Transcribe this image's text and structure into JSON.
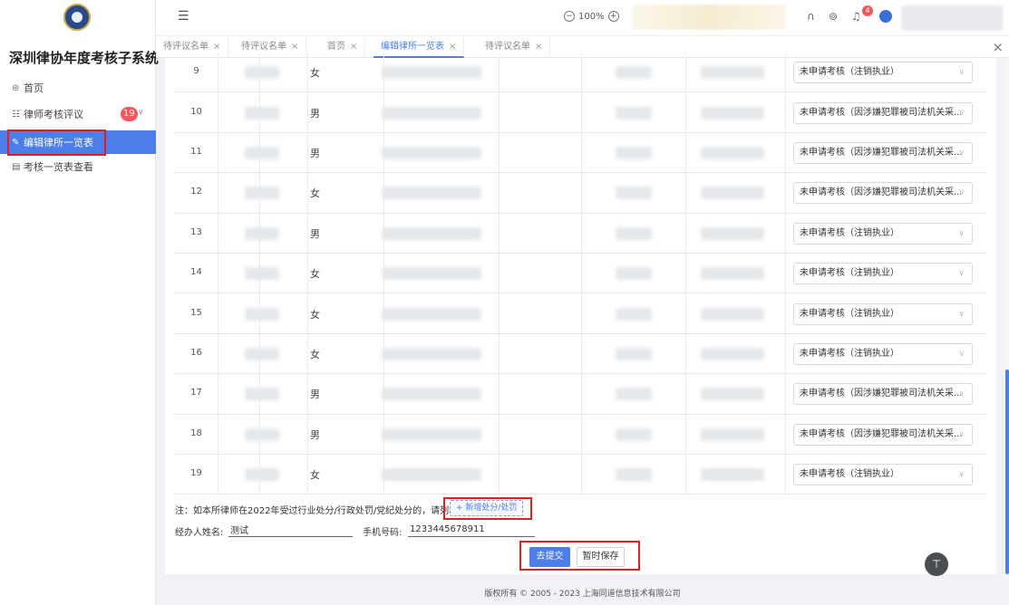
{
  "sidebar": {
    "title": "深圳律协年度考核子系统",
    "items": [
      {
        "icon": "home-icon",
        "label": "首页"
      },
      {
        "icon": "list-icon",
        "label": "律师考核评议",
        "badge": "19"
      },
      {
        "icon": "edit-icon",
        "label": "编辑律所一览表"
      },
      {
        "icon": "document-icon",
        "label": "考核一览表查看"
      }
    ]
  },
  "header": {
    "zoom": "100%"
  },
  "tabs": [
    {
      "label": "待评议名单"
    },
    {
      "label": "待评议名单"
    },
    {
      "label": "首页"
    },
    {
      "label": "编辑律所一览表"
    },
    {
      "label": "待评议名单"
    }
  ],
  "table": {
    "rows": [
      {
        "num": "9",
        "gender": "女",
        "status": "未申请考核（注销执业）"
      },
      {
        "num": "10",
        "gender": "男",
        "status": "未申请考核（因涉嫌犯罪被司法机关采..."
      },
      {
        "num": "11",
        "gender": "男",
        "status": "未申请考核（因涉嫌犯罪被司法机关采..."
      },
      {
        "num": "12",
        "gender": "女",
        "status": "未申请考核（因涉嫌犯罪被司法机关采..."
      },
      {
        "num": "13",
        "gender": "男",
        "status": "未申请考核（注销执业）"
      },
      {
        "num": "14",
        "gender": "女",
        "status": "未申请考核（注销执业）"
      },
      {
        "num": "15",
        "gender": "女",
        "status": "未申请考核（注销执业）"
      },
      {
        "num": "16",
        "gender": "女",
        "status": "未申请考核（注销执业）"
      },
      {
        "num": "17",
        "gender": "男",
        "status": "未申请考核（因涉嫌犯罪被司法机关采..."
      },
      {
        "num": "18",
        "gender": "男",
        "status": "未申请考核（因涉嫌犯罪被司法机关采..."
      },
      {
        "num": "19",
        "gender": "女",
        "status": "未申请考核（注销执业）"
      }
    ]
  },
  "form": {
    "note": "注：如本所律师在2022年受过行业处分/行政处罚/党纪处分的，请列明",
    "add_button": "+ 新增处分/处罚",
    "handler_label": "经办人姓名:",
    "handler_value": "测试",
    "phone_label": "手机号码:",
    "phone_value": "1233445678911",
    "submit_label": "去提交",
    "save_label": "暂时保存"
  },
  "footer": {
    "copyright": "版权所有 © 2005 - 2023 上海同道信息技术有限公司"
  },
  "colors": {
    "accent": "#4d7de8",
    "badge": "#f5565c",
    "highlight": "#e02020"
  }
}
